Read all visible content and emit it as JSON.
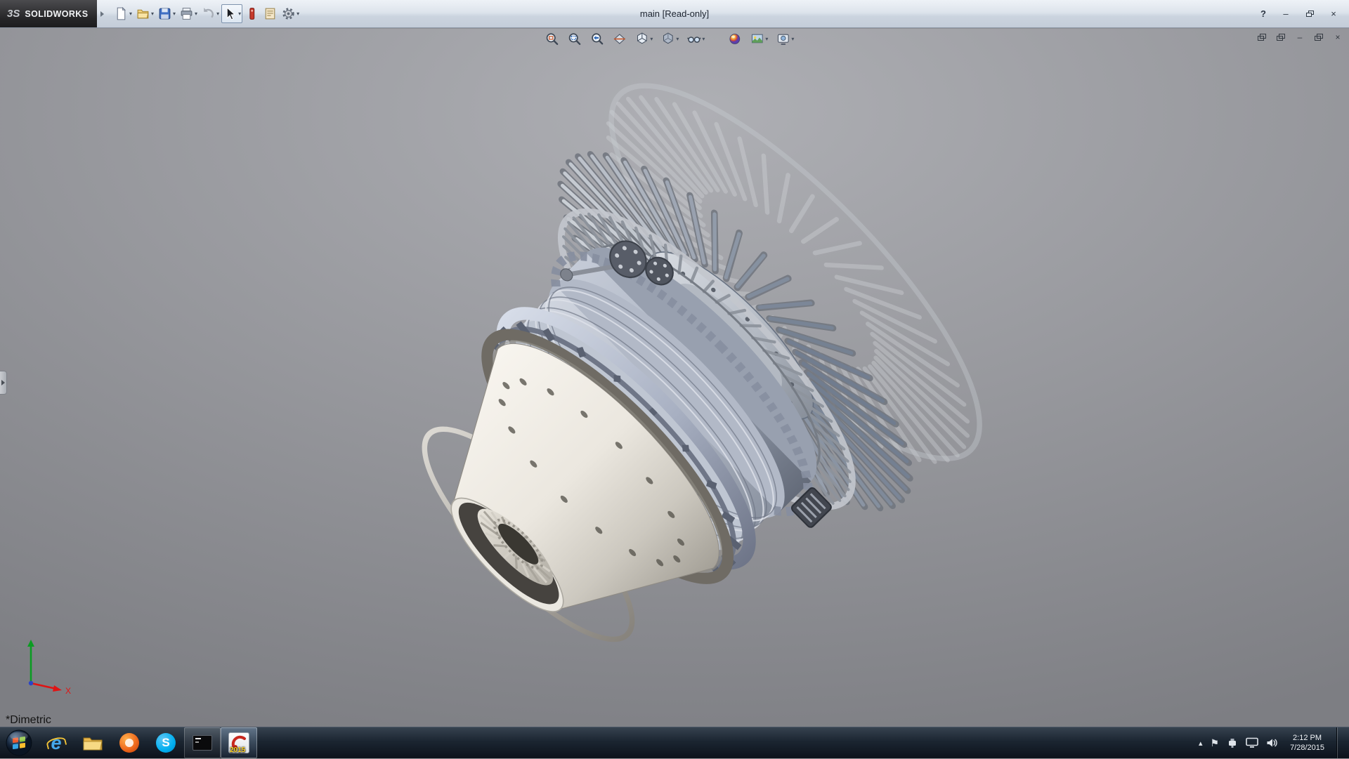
{
  "ui": {
    "dropdown_glyph": "▾"
  },
  "titlebar": {
    "brand_mark": "3S",
    "brand": "SOLIDWORKS",
    "title": "main [Read-only]",
    "help_glyph": "?",
    "minimize_glyph": "–",
    "close_glyph": "×"
  },
  "quick_access_toolbar": {
    "items": [
      {
        "name": "new-document"
      },
      {
        "name": "open"
      },
      {
        "name": "save"
      },
      {
        "name": "print"
      },
      {
        "name": "undo"
      },
      {
        "name": "select"
      },
      {
        "name": "rebuild"
      },
      {
        "name": "file-properties"
      },
      {
        "name": "options"
      }
    ]
  },
  "heads_up_toolbar": {
    "items": [
      "zoom-to-fit",
      "zoom-to-area",
      "previous-view",
      "section-view",
      "view-orientation",
      "display-style",
      "hide-show-items",
      "edit-appearance",
      "apply-scene",
      "view-settings"
    ]
  },
  "document_controls": {
    "minimize_glyph": "–",
    "close_glyph": "×"
  },
  "viewport": {
    "orientation_label": "*Dimetric",
    "triad_x_label": "X"
  },
  "taskbar": {
    "solidworks_badge": "2015",
    "ie_glyph": "e",
    "skype_glyph": "S",
    "tray": {
      "hidden_icons_glyph": "▴",
      "flag_glyph": "⚑",
      "time": "2:12 PM",
      "date": "7/28/2015"
    }
  }
}
